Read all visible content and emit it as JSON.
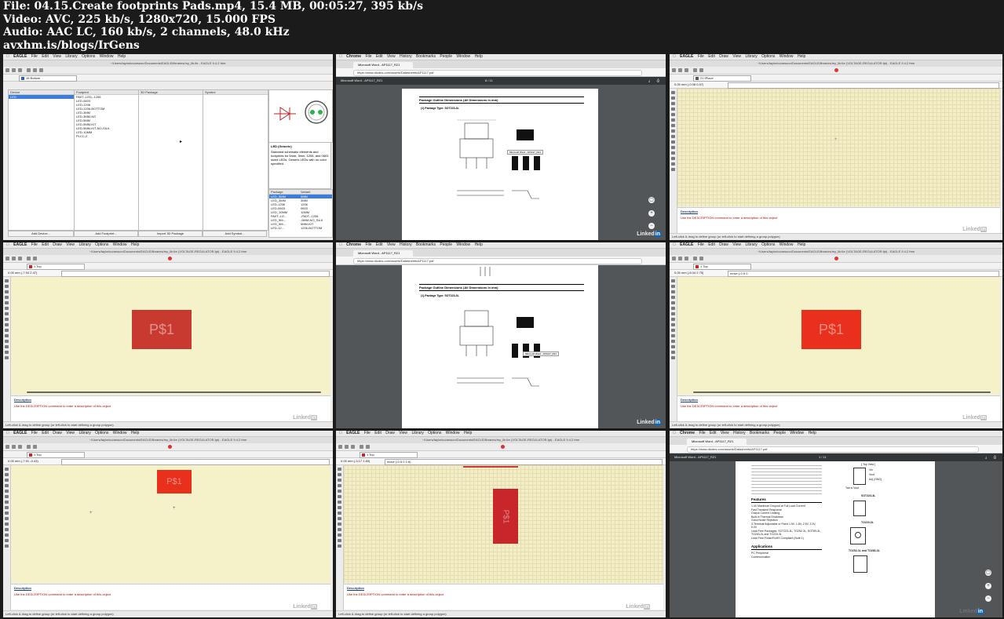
{
  "header": {
    "line1": "File: 04.15.Create footprints Pads.mp4, 15.4 MB, 00:05:27, 395 kb/s",
    "line2": "Video: AVC, 225 kb/s, 1280x720, 15.000 FPS",
    "line3": "Audio: AAC LC, 160 kb/s, 2 channels, 48.0 kHz",
    "line4": "avxhm.is/blogs/IrGens"
  },
  "eagle_menu": [
    "EAGLE",
    "File",
    "Edit",
    "View",
    "Library",
    "Options",
    "Window",
    "Help"
  ],
  "eagle_menu_draw": [
    "EAGLE",
    "File",
    "Edit",
    "Draw",
    "View",
    "Library",
    "Options",
    "Window",
    "Help"
  ],
  "chrome_menu": [
    "Chrome",
    "File",
    "Edit",
    "View",
    "History",
    "Bookmarks",
    "People",
    "Window",
    "Help"
  ],
  "eagle_title_lib": "~/Users/taylorkovarsson/Documents/EAGLE/libraries/my_lib.lbr - EAGLE 9.4.2 free",
  "eagle_title_pkg": "~/Users/taylorkovarsson/Documents/EAGLE/libraries/my_lib.lbr (VOLTAGE-REGULATOR.fpt) - EAGLE 9.4.2 free",
  "layers": {
    "bottom": "16 Bottom",
    "tplace": "21 tPlace",
    "top": "1 Top"
  },
  "coords": {
    "t3": "0.05 mm (-0.08 0.07)",
    "t4": "0.05 mm (-7.93 2.47)",
    "t6": "0.05 mm (-6.04 2.75)",
    "t7": "0.05 mm (-7.91 -0.43)",
    "t8": "0.05 mm (-3.17 1.83)"
  },
  "commands": {
    "t6": "move (-0.5 0",
    "t8": "move (-0.5 0 2.6)"
  },
  "pad_label": "P$1",
  "description": {
    "heading": "Description",
    "message": "Use the DESCRIPTION command to enter a description of this object."
  },
  "status": "Left-click & drag to define group (or left-click to start defining a group polygon)",
  "chrome": {
    "tab": "Microsoft Word - AP1117_R21",
    "url": "https://www.diodes.com/assets/Datasheets/AP1117.pdf",
    "pdf_title": "Microsoft Word - AP1117_R21",
    "page_a": "8 / 11",
    "page_b": "1 / 11",
    "section": "Package Outline Dimensions (All Dimensions in mm)",
    "package": "(1)  Package Type: SOT223-3L",
    "tooltip": "Microsoft Word - AP1117_R21"
  },
  "library": {
    "device_header": "Device",
    "footprint_header": "Footprint",
    "pkg3d_header": "3D Package",
    "symbol_header": "Symbol",
    "devices": [
      "LED"
    ],
    "footprints": [
      "PA0T--LED--1206",
      "LED-0603",
      "LED-1206",
      "LED-1206-BOTTOM",
      "LED-3MM",
      "LED-3MM-NS",
      "LED-5MM",
      "LED-5MM-KIT",
      "LED-5MM-KIT-NO-SILK",
      "LED-10MM",
      "PLCC-2"
    ],
    "buttons": [
      "Add Device...",
      "Add Footprint...",
      "Import 3D Package",
      "Add Symbol..."
    ],
    "desc_title": "LED (Generic)",
    "desc_body": "Standard schematic elements and footprints for 5mm, 3mm, 1206, and 0603 sized LEDs. Generic LEDs with no color specified.",
    "variant_headers": [
      "Package",
      "Variant"
    ],
    "variants": [
      [
        "LED_5MM",
        "5MM"
      ],
      [
        "LED_3MM",
        "3MM"
      ],
      [
        "LED-1206",
        "1206"
      ],
      [
        "LED-0603",
        "0603"
      ],
      [
        "LED_10MM",
        "10MM"
      ],
      [
        "PA0T--LE...",
        "-PA0T--1206"
      ],
      [
        "LED_5M...",
        "-5MM-NO_SILK"
      ],
      [
        "LED_5M...",
        "5MM-KIT"
      ],
      [
        "LED-12...",
        "1206-BOTTOM"
      ]
    ]
  },
  "datasheet": {
    "features_title": "Features",
    "features": [
      "1.4V Maximum Dropout at Full Load Current",
      "Fast Transient Response",
      "Output Current Limiting",
      "Built-in Thermal Shutdown",
      "Good Noise Rejection",
      "3-Terminal Adjustable or Fixed 1.5V, 1.8V, 2.5V, 3.3V, 5.0V",
      "Lead Free Packages: SOT223-3L, TO252-3L, SOT89-3L, TO263-3L and TO220-3L",
      "Lead Free Finish/RoHS Compliant (Note 1)"
    ],
    "apps_title": "Applications",
    "apps": [
      "PC Peripheral",
      "Communication"
    ],
    "pins": [
      "Vin",
      "Vout",
      "Adj (GND)"
    ],
    "pkgs": [
      "( Top View )",
      "SOT223-3L",
      "TO220-3L",
      "TO252-3L and TO263-3L"
    ],
    "tab_label": "Tab is Vout"
  },
  "watermark": "Linked"
}
